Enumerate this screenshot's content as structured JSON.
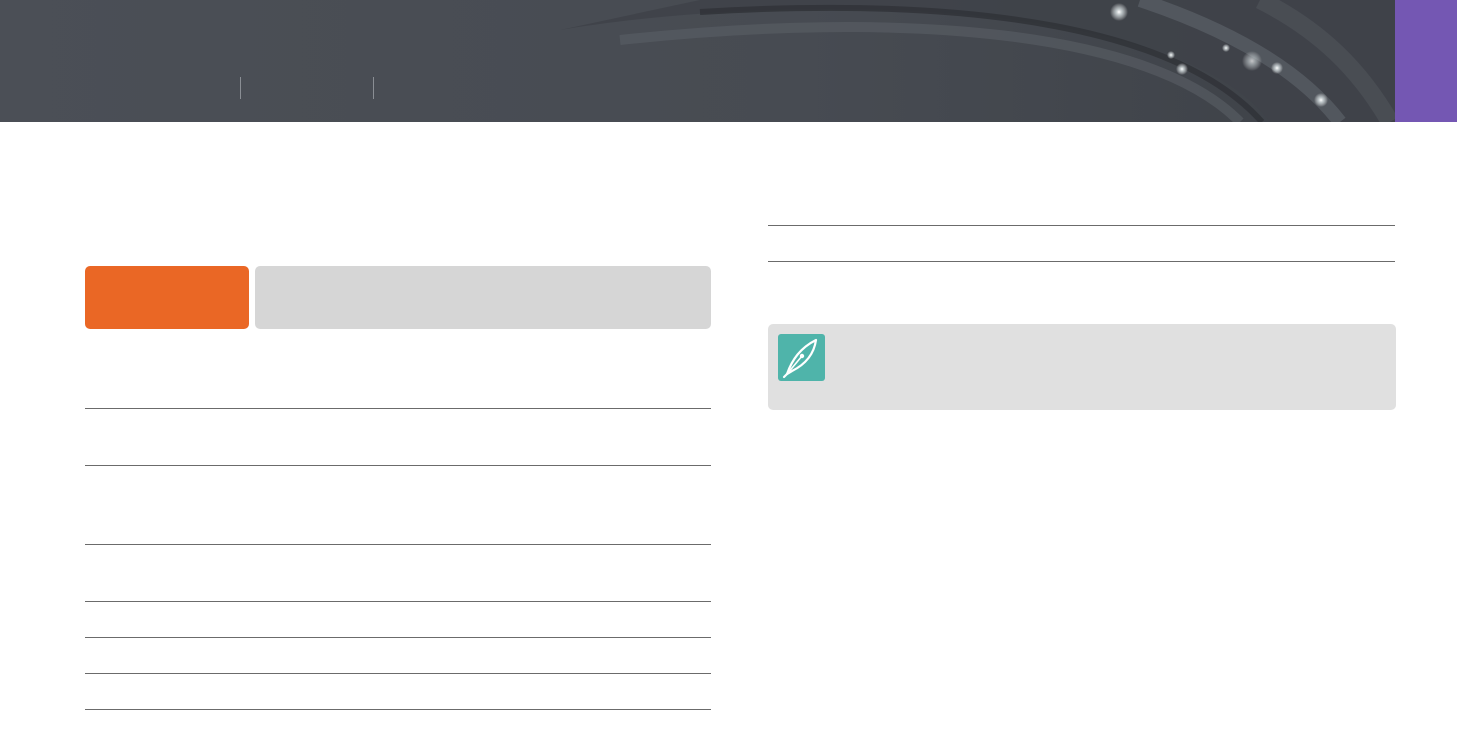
{
  "header": {
    "breadcrumbs": [
      "",
      "",
      ""
    ],
    "accent_color": "#7457b3",
    "icons": [
      "starry-arc-banner"
    ]
  },
  "section": {
    "tab_label": "",
    "bar_label": "",
    "tab_color": "#ea6725"
  },
  "left_table": {
    "headers": [
      "",
      ""
    ],
    "rows": [
      [
        "",
        ""
      ],
      [
        "",
        ""
      ],
      [
        "",
        ""
      ],
      [
        "",
        ""
      ],
      [
        "",
        ""
      ],
      [
        "",
        ""
      ],
      [
        "",
        ""
      ]
    ]
  },
  "right_table": {
    "headers": [
      "",
      ""
    ],
    "rows": [
      [
        "",
        ""
      ],
      [
        "",
        ""
      ]
    ]
  },
  "note": {
    "text": "",
    "icon": "pen-nib-icon",
    "icon_color": "#4fb4aa"
  }
}
